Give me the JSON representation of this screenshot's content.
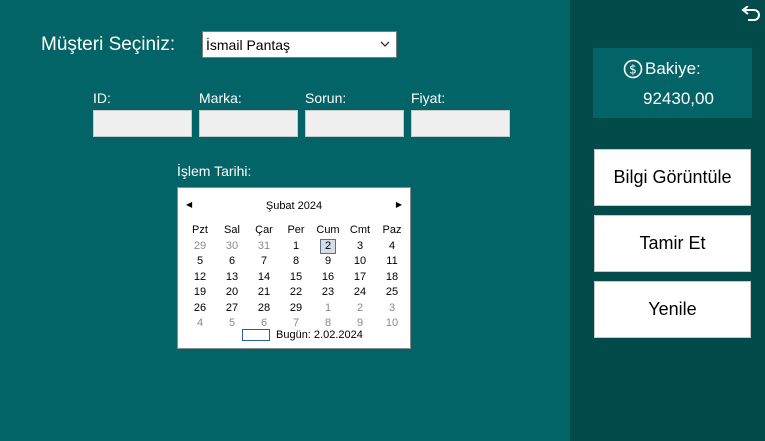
{
  "form": {
    "customer_label": "Müşteri Seçiniz:",
    "customer_value": "İsmail Pantaş",
    "fields": [
      {
        "label": "ID:",
        "value": ""
      },
      {
        "label": "Marka:",
        "value": ""
      },
      {
        "label": "Sorun:",
        "value": ""
      },
      {
        "label": "Fiyat:",
        "value": ""
      }
    ],
    "date_label": "İşlem Tarihi:"
  },
  "calendar": {
    "month_title": "Şubat 2024",
    "weekdays": [
      "Pzt",
      "Sal",
      "Çar",
      "Per",
      "Cum",
      "Cmt",
      "Paz"
    ],
    "weeks": [
      [
        "29",
        "30",
        "31",
        "1",
        "2",
        "3",
        "4"
      ],
      [
        "5",
        "6",
        "7",
        "8",
        "9",
        "10",
        "11"
      ],
      [
        "12",
        "13",
        "14",
        "15",
        "16",
        "17",
        "18"
      ],
      [
        "19",
        "20",
        "21",
        "22",
        "23",
        "24",
        "25"
      ],
      [
        "26",
        "27",
        "28",
        "29",
        "1",
        "2",
        "3"
      ],
      [
        "4",
        "5",
        "6",
        "7",
        "8",
        "9",
        "10"
      ]
    ],
    "selected": "2",
    "today_text": "Bugün: 2.02.2024"
  },
  "sidebar": {
    "balance_label": "Bakiye:",
    "balance_value": "92430,00",
    "buttons": [
      "Bilgi Görüntüle",
      "Tamir Et",
      "Yenile"
    ]
  },
  "colors": {
    "main_bg": "#036467",
    "side_bg": "#034a4b"
  }
}
